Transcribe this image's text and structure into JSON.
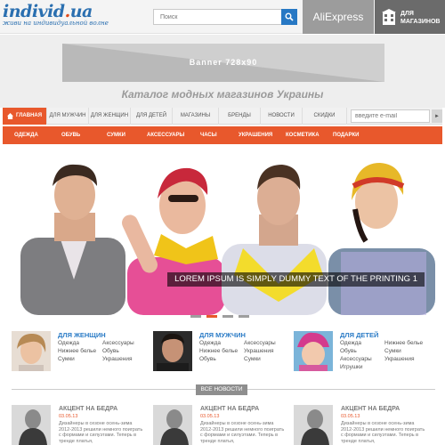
{
  "header": {
    "logo_main": "individ",
    "logo_dot": ".",
    "logo_tld": "ua",
    "logo_tagline": "живи на индивидуальной волне",
    "search_placeholder": "Поиск",
    "aliexpress": "AliExpress",
    "for_shops_line1": "ДЛЯ",
    "for_shops_line2": "МАГАЗИНОВ"
  },
  "banner": {
    "label": "Banner  728x90",
    "catalog_title": "Каталог модных магазинов Украины"
  },
  "nav": {
    "items": [
      {
        "label": "ГЛАВНАЯ"
      },
      {
        "label": "ДЛЯ МУЖЧИН"
      },
      {
        "label": "ДЛЯ ЖЕНЩИН"
      },
      {
        "label": "ДЛЯ ДЕТЕЙ"
      },
      {
        "label": "МАГАЗИНЫ"
      },
      {
        "label": "БРЕНДЫ"
      },
      {
        "label": "НОВОСТИ"
      },
      {
        "label": "СКИДКИ"
      }
    ],
    "email_placeholder": "введите e-mail",
    "arrow": "►"
  },
  "subnav": {
    "items": [
      "ОДЕЖДА",
      "ОБУВЬ",
      "СУМКИ",
      "АКСЕССУАРЫ",
      "ЧАСЫ",
      "УКРАШЕНИЯ",
      "КОСМЕТИКА",
      "ПОДАРКИ"
    ]
  },
  "hero": {
    "caption": "LOREM IPSUM IS SIMPLY DUMMY TEXT OF THE PRINTING 1",
    "slides": 4,
    "active_slide": 2
  },
  "categories": [
    {
      "title": "ДЛЯ ЖЕНЩИН",
      "links": [
        "Одежда",
        "Нижнее белье",
        "Сумки",
        "Аксессуары",
        "Обувь",
        "Украшения"
      ]
    },
    {
      "title": "ДЛЯ МУЖЧИН",
      "links": [
        "Одежда",
        "Нижнее белье",
        "Обувь",
        "Аксессуары",
        "Украшения",
        "Сумки"
      ]
    },
    {
      "title": "ДЛЯ ДЕТЕЙ",
      "links": [
        "Одежда",
        "Обувь",
        "Аксессуары",
        "Игрушки",
        "Нижнее белье",
        "Сумки",
        "Украшения"
      ]
    }
  ],
  "news": {
    "label": "ВСЕ НОВОСТИ",
    "items": [
      {
        "title": "АКЦЕНТ НА БЕДРА",
        "date": "03.05.13",
        "text": "Дизайнеры в сезоне осень-зима 2012-2013 решили немного поиграть с формами и силуэтами. Теперь в тренде платья,"
      },
      {
        "title": "АКЦЕНТ НА БЕДРА",
        "date": "03.05.13",
        "text": "Дизайнеры в сезоне осень-зима 2012-2013 решили немного поиграть с формами и силуэтами. Теперь в тренде платья,"
      },
      {
        "title": "АКЦЕНТ НА БЕДРА",
        "date": "03.05.13",
        "text": "Дизайнеры в сезоне осень-зима 2012-2013 решили немного поиграть с формами и силуэтами. Теперь в тренде платья,"
      }
    ]
  },
  "colors": {
    "accent": "#e8582c",
    "brand_blue": "#2a7bc6",
    "header_bg": "#f4f4f4"
  }
}
